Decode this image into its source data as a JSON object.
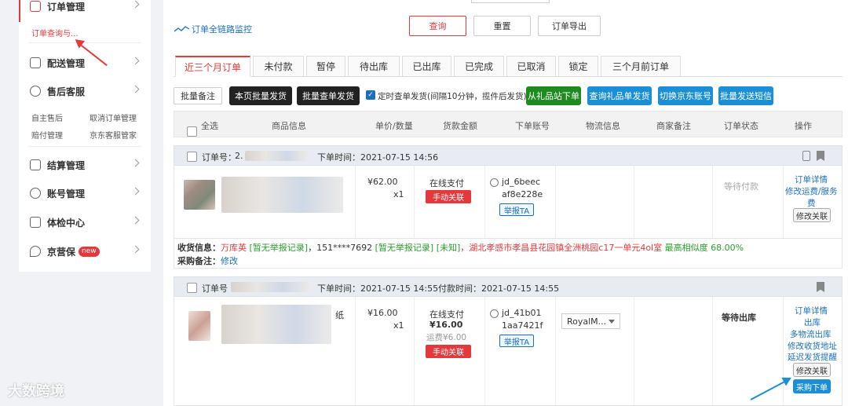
{
  "sidebar": {
    "order_mgmt": "订单管理",
    "order_query": "订单查询与...",
    "delivery": "配送管理",
    "after_sales": "售后客服",
    "sub_links": [
      "自主售后",
      "取消订单管理",
      "赔付管理",
      "京东客服管家"
    ],
    "settlement": "结算管理",
    "account": "账号管理",
    "health": "体检中心",
    "jyb": "京营保",
    "new_badge": "new"
  },
  "toolbar": {
    "monitor_link": "订单全链路监控",
    "query": "查询",
    "reset": "重置",
    "export": "订单导出"
  },
  "tabs": [
    "近三个月订单",
    "未付款",
    "暂停",
    "待出库",
    "已出库",
    "已完成",
    "已取消",
    "锁定",
    "三个月前订单"
  ],
  "actions": {
    "batch_note": "批量备注",
    "page_batch_ship": "本页批量发货",
    "batch_check_ship": "批量查单发货",
    "timed_ship": "定时查单发货(间隔10分钟，揽件后发货)",
    "gift_order": "从礼品站下单",
    "query_gift": "查询礼品单发货",
    "switch_jd": "切换京东账号",
    "batch_sms": "批量发送短信"
  },
  "columns": [
    "全选",
    "商品信息",
    "单价/数量",
    "货款金额",
    "下单账号",
    "物流信息",
    "商家备注",
    "订单状态",
    "操作"
  ],
  "orders": [
    {
      "no_label": "订单号：",
      "no_partial": "2.",
      "order_time": "下单时间：2021-07-15 14:56",
      "price": "¥62.00",
      "qty": "x1",
      "payment": "在线支付",
      "manual_link": "手动关联",
      "account_l1": "jd_6beec",
      "account_l2": "af8e228e",
      "report": "举报TA",
      "status": "等待付款",
      "ops": [
        "订单详情",
        "修改运费/服务",
        "费"
      ],
      "modify_link": "修改关联",
      "receiver_label": "收货信息：",
      "receiver_name": "万库英",
      "no_report_1": "[暂无举报记录]",
      "phone": "，151****7692",
      "no_report_2": "[暂无举报记录]",
      "unknown": "[未知]",
      "address": "，湖北孝感市孝昌县花园镇全洲桃园c17一单元4ol室",
      "similarity": "最高相似度 68.00%",
      "purchase_note_label": "采购备注：",
      "purchase_note_edit": "修改"
    },
    {
      "no_label": "订单号",
      "order_time": "下单时间：2021-07-15 14:55",
      "pay_time": "付款时间：2021-07-15 14:55",
      "product_tail": "纸",
      "price": "¥16.00",
      "qty": "x1",
      "payment": "在线支付",
      "amount": "¥16.00",
      "shipping": "运费¥6.00",
      "manual_link": "手动关联",
      "account_l1": "jd_41b01",
      "account_l2": "1aa7421f",
      "report": "举报TA",
      "logistics": "RoyalM...",
      "status": "等待出库",
      "ops": [
        "订单详情",
        "出库",
        "多物流出库",
        "修改收货地址",
        "延迟发货提醒"
      ],
      "modify_link": "修改关联",
      "purchase_order": "采购下单"
    }
  ],
  "watermark": "大数跨境",
  "colors": {
    "accent": "#e4393c",
    "link": "#1b6fbf",
    "green": "#2a9d2a",
    "blue_btn": "#1b8fd6"
  }
}
